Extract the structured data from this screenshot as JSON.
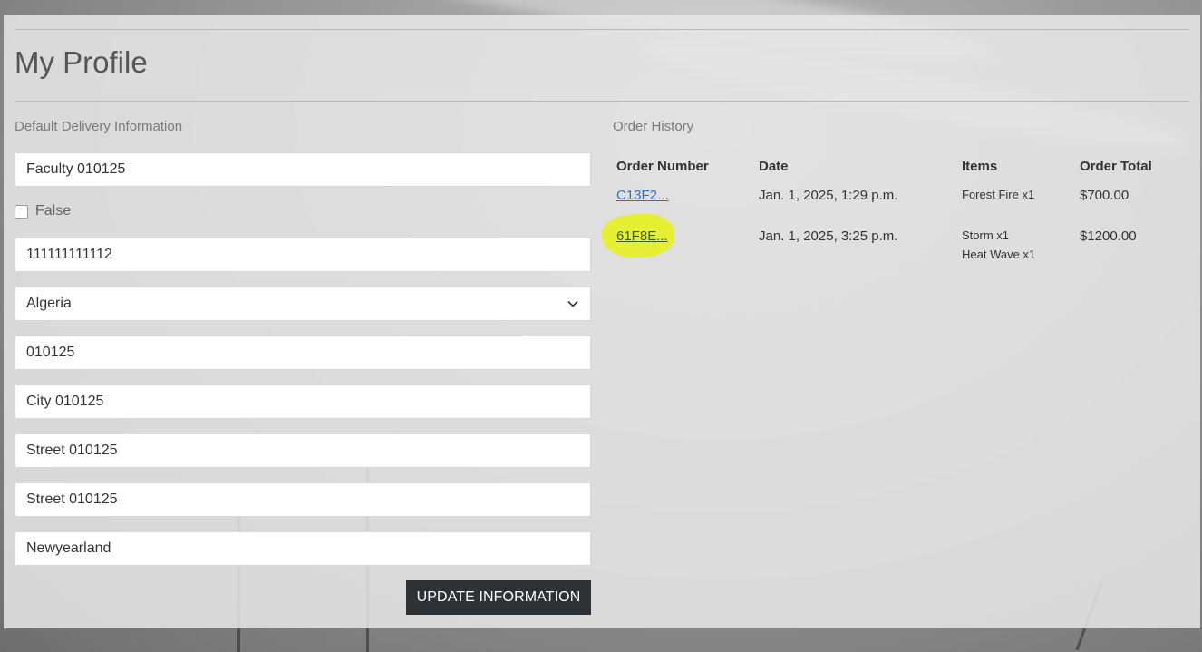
{
  "page": {
    "title": "My Profile"
  },
  "delivery": {
    "heading": "Default Delivery Information",
    "full_name": "Faculty  010125",
    "checkbox_label": "False",
    "phone": "111111111112",
    "country": "Algeria",
    "postcode": "010125",
    "town_or_city": "City 010125",
    "street_address1": "Street  010125",
    "street_address2": "Street  010125",
    "county": "Newyearland",
    "update_button": "UPDATE INFORMATION"
  },
  "orders": {
    "heading": "Order History",
    "columns": [
      "Order Number",
      "Date",
      "Items",
      "Order Total"
    ],
    "rows": [
      {
        "number": "C13F2...",
        "date": "Jan. 1, 2025, 1:29 p.m.",
        "items": [
          "Forest Fire x1"
        ],
        "total": "$700.00"
      },
      {
        "number": "61F8E...",
        "date": "Jan. 1, 2025, 3:25 p.m.",
        "items": [
          "Storm x1",
          "Heat Wave x1"
        ],
        "total": "$1200.00"
      }
    ]
  },
  "colors": {
    "link": "#2a6fd6",
    "highlight": "#e6ef2a",
    "button_bg": "#2e3236"
  }
}
